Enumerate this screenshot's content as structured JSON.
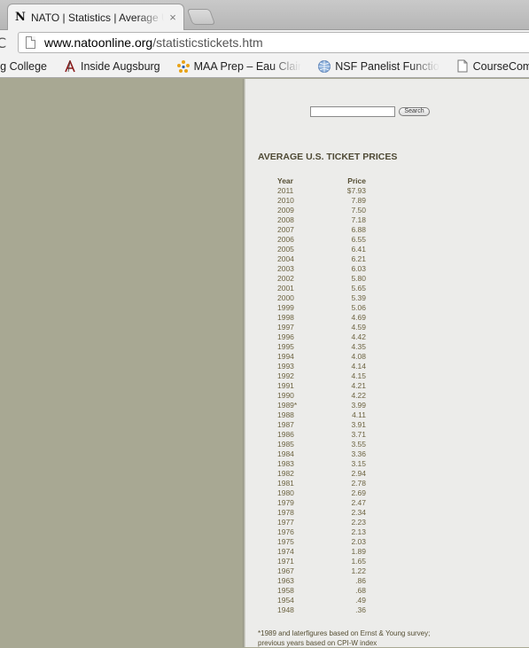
{
  "browser": {
    "tab": {
      "favicon": "N",
      "title": "NATO | Statistics | Average U",
      "close": "×"
    },
    "reload_glyph": "C",
    "url": {
      "host": "www.natoonline.org",
      "path": "/statisticstickets.htm"
    },
    "bookmarks": [
      {
        "label": "rg College",
        "icon": ""
      },
      {
        "label": "Inside Augsburg",
        "icon": "augsburg-a-icon"
      },
      {
        "label": "MAA Prep – Eau Clair",
        "icon": "maa-star-icon"
      },
      {
        "label": "NSF Panelist Functio",
        "icon": "nsf-globe-icon"
      },
      {
        "label": "CourseCompa",
        "icon": "page-icon"
      }
    ]
  },
  "page": {
    "search": {
      "value": "",
      "button_label": "Search"
    },
    "heading": "AVERAGE U.S. TICKET PRICES",
    "table": {
      "headers": {
        "year": "Year",
        "price": "Price"
      },
      "rows": [
        [
          "2011",
          "$7.93"
        ],
        [
          "2010",
          "7.89"
        ],
        [
          "2009",
          "7.50"
        ],
        [
          "2008",
          "7.18"
        ],
        [
          "2007",
          "6.88"
        ],
        [
          "2006",
          "6.55"
        ],
        [
          "2005",
          "6.41"
        ],
        [
          "2004",
          "6.21"
        ],
        [
          "2003",
          "6.03"
        ],
        [
          "2002",
          "5.80"
        ],
        [
          "2001",
          "5.65"
        ],
        [
          "2000",
          "5.39"
        ],
        [
          "1999",
          "5.06"
        ],
        [
          "1998",
          "4.69"
        ],
        [
          "1997",
          "4.59"
        ],
        [
          "1996",
          "4.42"
        ],
        [
          "1995",
          "4.35"
        ],
        [
          "1994",
          "4.08"
        ],
        [
          "1993",
          "4.14"
        ],
        [
          "1992",
          "4.15"
        ],
        [
          "1991",
          "4.21"
        ],
        [
          "1990",
          "4.22"
        ],
        [
          "1989*",
          "3.99"
        ],
        [
          "1988",
          "4.11"
        ],
        [
          "1987",
          "3.91"
        ],
        [
          "1986",
          "3.71"
        ],
        [
          "1985",
          "3.55"
        ],
        [
          "1984",
          "3.36"
        ],
        [
          "1983",
          "3.15"
        ],
        [
          "1982",
          "2.94"
        ],
        [
          "1981",
          "2.78"
        ],
        [
          "1980",
          "2.69"
        ],
        [
          "1979",
          "2.47"
        ],
        [
          "1978",
          "2.34"
        ],
        [
          "1977",
          "2.23"
        ],
        [
          "1976",
          "2.13"
        ],
        [
          "1975",
          "2.03"
        ],
        [
          "1974",
          "1.89"
        ],
        [
          "1971",
          "1.65"
        ],
        [
          "1967",
          "1.22"
        ],
        [
          "1963",
          ".86"
        ],
        [
          "1958",
          ".68"
        ],
        [
          "1954",
          ".49"
        ],
        [
          "1948",
          ".36"
        ]
      ]
    },
    "footnote": {
      "line1": "*1989 and laterfigures based on Ernst & Young survey;",
      "line2": "previous years based on CPI-W index"
    }
  },
  "colors": {
    "sidebar": "#a8a893",
    "content_bg": "#ececea",
    "text": "#6d6442"
  }
}
